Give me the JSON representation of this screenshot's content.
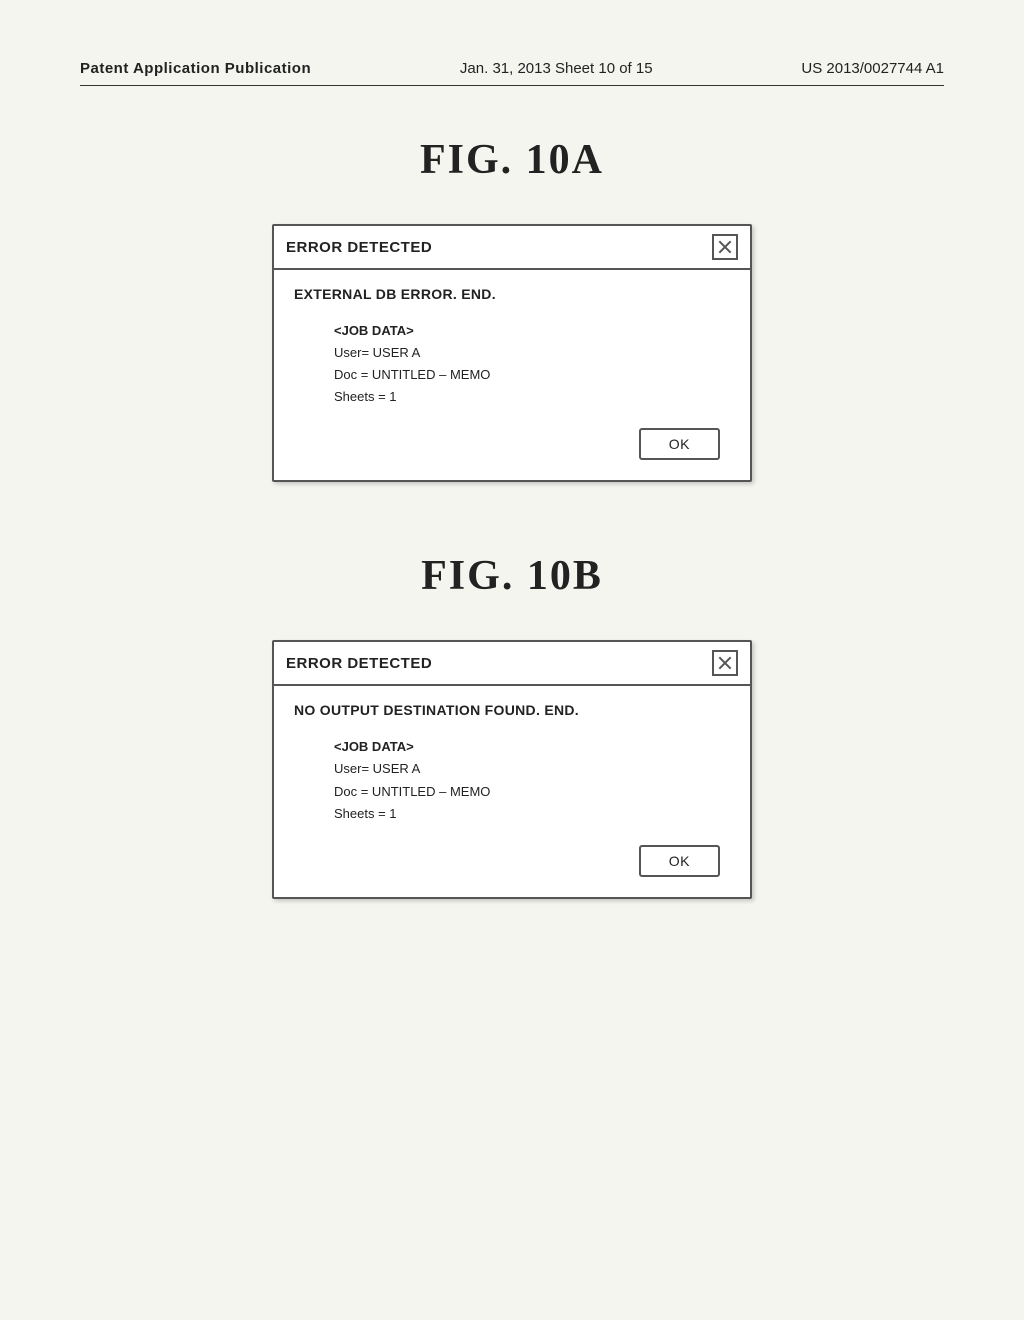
{
  "header": {
    "left_label": "Patent Application Publication",
    "middle_label": "Jan. 31, 2013  Sheet 10 of 15",
    "right_label": "US 2013/0027744 A1"
  },
  "figures": [
    {
      "id": "fig10a",
      "title": "FIG. 10A",
      "dialog": {
        "titlebar": "ERROR DETECTED",
        "close_label": "×",
        "error_message": "EXTERNAL DB ERROR.  END.",
        "job_data_label": "<JOB DATA>",
        "user_line": "User= USER A",
        "doc_line": "Doc = UNTITLED – MEMO",
        "sheets_line": "Sheets = 1",
        "ok_label": "OK"
      }
    },
    {
      "id": "fig10b",
      "title": "FIG. 10B",
      "dialog": {
        "titlebar": "ERROR DETECTED",
        "close_label": "×",
        "error_message": "NO OUTPUT DESTINATION FOUND.  END.",
        "job_data_label": "<JOB DATA>",
        "user_line": "User= USER A",
        "doc_line": "Doc = UNTITLED – MEMO",
        "sheets_line": "Sheets = 1",
        "ok_label": "OK"
      }
    }
  ]
}
